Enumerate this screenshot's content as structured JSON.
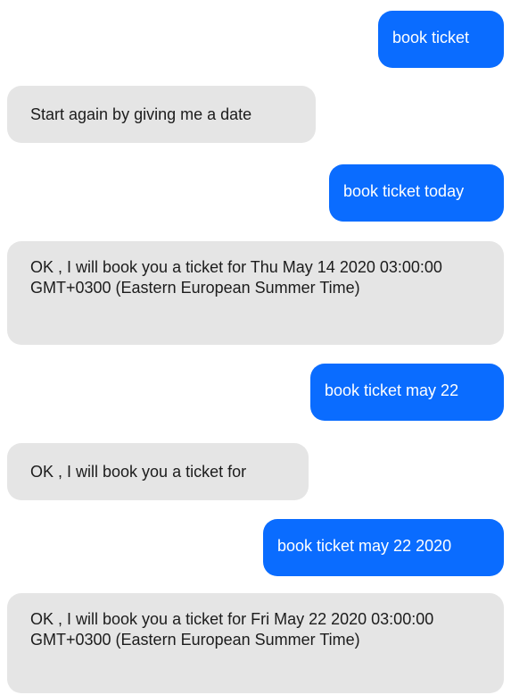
{
  "chat": {
    "messages": [
      {
        "sender": "user",
        "text": "book ticket"
      },
      {
        "sender": "bot",
        "text": "Start again by giving me a date"
      },
      {
        "sender": "user",
        "text": "book ticket today"
      },
      {
        "sender": "bot",
        "text": "OK , I will book you a ticket for Thu May 14 2020 03:00:00 GMT+0300 (Eastern European Summer Time)"
      },
      {
        "sender": "user",
        "text": "book ticket may 22"
      },
      {
        "sender": "bot",
        "text": "OK , I will book you a ticket for"
      },
      {
        "sender": "user",
        "text": "book ticket may 22 2020"
      },
      {
        "sender": "bot",
        "text": "OK , I will book you a ticket for Fri May 22 2020 03:00:00 GMT+0300 (Eastern European Summer Time)"
      }
    ]
  },
  "colors": {
    "user_bubble": "#0a6cff",
    "bot_bubble": "#e5e5e5",
    "user_text": "#ffffff",
    "bot_text": "#1c1c1c"
  }
}
